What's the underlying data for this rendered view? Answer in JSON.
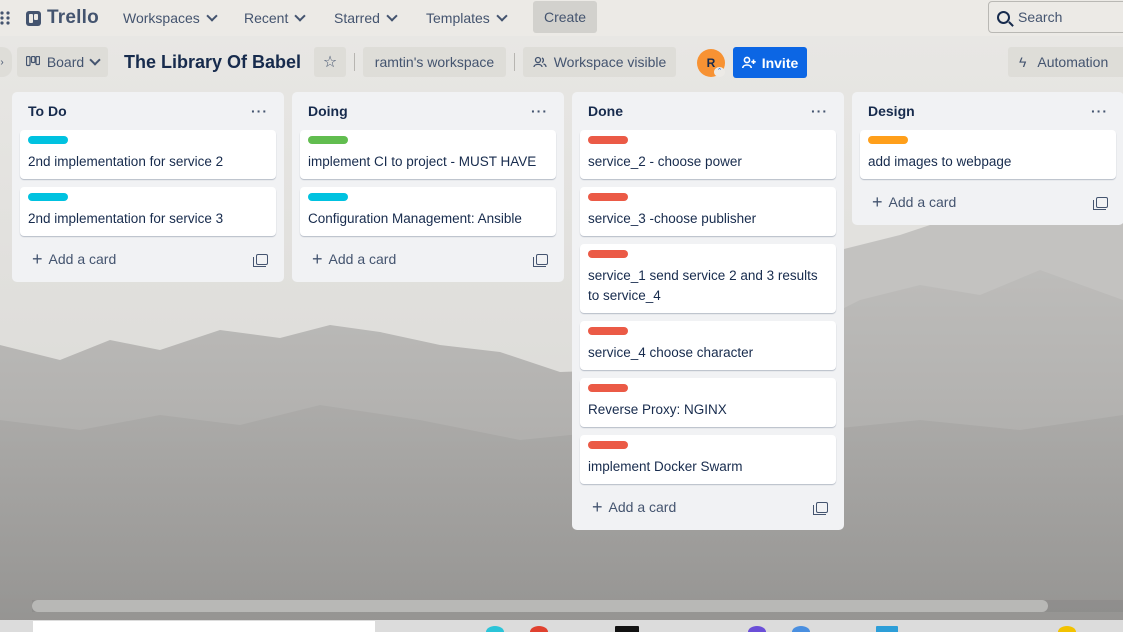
{
  "topbar": {
    "logo": "Trello",
    "nav": [
      "Workspaces",
      "Recent",
      "Starred",
      "Templates"
    ],
    "create": "Create",
    "search_placeholder": "Search"
  },
  "board": {
    "view": "Board",
    "title": "The Library Of Babel",
    "workspace": "ramtin's workspace",
    "visibility": "Workspace visible",
    "avatar_initial": "R",
    "invite": "Invite",
    "automation": "Automation"
  },
  "colors": {
    "cyan": "#00c2e0",
    "green": "#61bd4f",
    "red": "#eb5a46",
    "orange": "#ff9f1a",
    "invite": "#0c66e4"
  },
  "lists": [
    {
      "title": "To Do",
      "cards": [
        {
          "label_color": "#00c2e0",
          "text": "2nd implementation for service 2"
        },
        {
          "label_color": "#00c2e0",
          "text": "2nd implementation for service 3"
        }
      ],
      "add": "Add a card"
    },
    {
      "title": "Doing",
      "cards": [
        {
          "label_color": "#61bd4f",
          "text": "implement CI to project - MUST HAVE"
        },
        {
          "label_color": "#00c2e0",
          "text": "Configuration Management: Ansible"
        }
      ],
      "add": "Add a card"
    },
    {
      "title": "Done",
      "cards": [
        {
          "label_color": "#eb5a46",
          "text": "service_2 - choose power"
        },
        {
          "label_color": "#eb5a46",
          "text": "service_3 -choose publisher"
        },
        {
          "label_color": "#eb5a46",
          "text": "service_1 send service 2 and 3 results to service_4"
        },
        {
          "label_color": "#eb5a46",
          "text": "service_4 choose character"
        },
        {
          "label_color": "#eb5a46",
          "text": "Reverse Proxy: NGINX"
        },
        {
          "label_color": "#eb5a46",
          "text": "implement Docker Swarm"
        }
      ],
      "add": "Add a card"
    },
    {
      "title": "Design",
      "cards": [
        {
          "label_color": "#ff9f1a",
          "text": "add images to webpage"
        }
      ],
      "add": "Add a card"
    }
  ]
}
